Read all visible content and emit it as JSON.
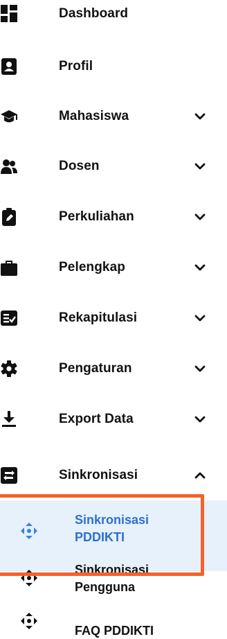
{
  "menu": {
    "items": [
      {
        "label": "Dashboard",
        "icon": "dashboard-icon",
        "has_chevron": false
      },
      {
        "label": "Profil",
        "icon": "profile-card-icon",
        "has_chevron": false
      },
      {
        "label": "Mahasiswa",
        "icon": "graduation-cap-icon",
        "has_chevron": true,
        "chevron": "chevron-down-icon"
      },
      {
        "label": "Dosen",
        "icon": "users-icon",
        "has_chevron": true,
        "chevron": "chevron-down-icon"
      },
      {
        "label": "Perkuliahan",
        "icon": "clipboard-edit-icon",
        "has_chevron": true,
        "chevron": "chevron-down-icon"
      },
      {
        "label": "Pelengkap",
        "icon": "briefcase-icon",
        "has_chevron": true,
        "chevron": "chevron-down-icon"
      },
      {
        "label": "Rekapitulasi",
        "icon": "checklist-icon",
        "has_chevron": true,
        "chevron": "chevron-down-icon"
      },
      {
        "label": "Pengaturan",
        "icon": "gear-icon",
        "has_chevron": true,
        "chevron": "chevron-down-icon"
      },
      {
        "label": "Export Data",
        "icon": "download-icon",
        "has_chevron": true,
        "chevron": "chevron-down-icon"
      },
      {
        "label": "Sinkronisasi",
        "icon": "sync-icon",
        "has_chevron": true,
        "chevron": "chevron-up-icon",
        "expanded": true
      }
    ],
    "submenu": [
      {
        "line1": "Sinkronisasi",
        "line2": "PDDIKTI",
        "icon": "arrows-icon",
        "active": true
      },
      {
        "line1": "Sinkronisasi",
        "line2": "Pengguna",
        "icon": "arrows-icon",
        "active": false
      },
      {
        "line1": "FAQ PDDIKTI",
        "line2": "",
        "icon": "arrows-icon",
        "active": false
      }
    ]
  },
  "colors": {
    "active_text": "#2d6fd0",
    "active_bg": "#e6f1fb",
    "active_icon": "#3b82e0",
    "highlight_border": "#f2622a",
    "text": "#111111"
  }
}
